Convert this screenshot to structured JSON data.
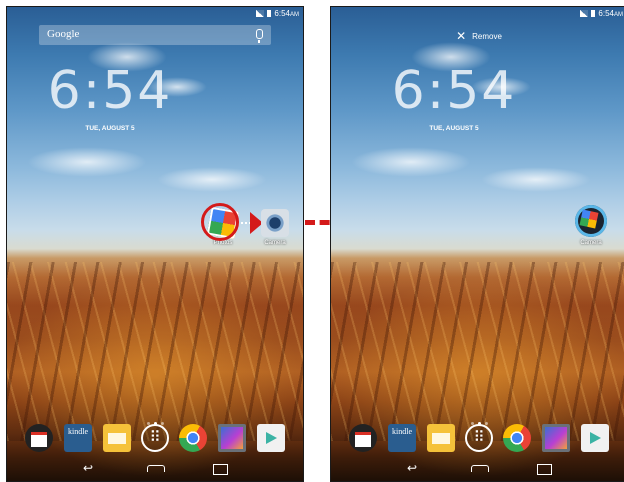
{
  "status_bar": {
    "time": "6:54",
    "ampm": "AM"
  },
  "search": {
    "label": "Google"
  },
  "lockscreen": {
    "time": "6:54",
    "date": "TUE, AUGUST 5"
  },
  "drag": {
    "remove_label": "Remove"
  },
  "apps": {
    "photos_label": "Photos",
    "camera_label": "Camera",
    "folder_label": "Camera"
  },
  "dock": {
    "kindle_label": "kindle",
    "items": [
      "gmail",
      "kindle",
      "email",
      "apps",
      "chrome",
      "gallery",
      "play-store"
    ]
  },
  "colors": {
    "annotation_red": "#d41a1a",
    "accent_blue": "#5ab7e8"
  }
}
